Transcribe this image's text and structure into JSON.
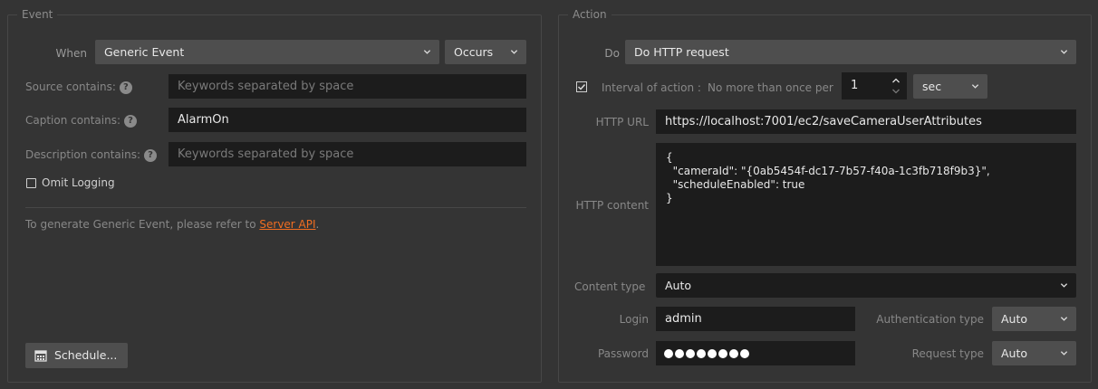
{
  "event": {
    "legend": "Event",
    "when_label": "When",
    "event_type": "Generic Event",
    "occurs": "Occurs",
    "source_label": "Source contains:",
    "source_placeholder": "Keywords separated by space",
    "caption_label": "Caption contains:",
    "caption_value": "AlarmOn",
    "description_label": "Description contains:",
    "description_placeholder": "Keywords separated by space",
    "omit_logging": "Omit Logging",
    "hint_prefix": "To generate Generic Event, please refer to ",
    "hint_link": "Server API",
    "hint_suffix": ".",
    "schedule_button": "Schedule..."
  },
  "action": {
    "legend": "Action",
    "do_label": "Do",
    "action_type": "Do HTTP request",
    "interval_label": "Interval of action :",
    "interval_text": "No more than once per",
    "interval_value": "1",
    "interval_unit": "sec",
    "url_label": "HTTP URL",
    "url_value": "https://localhost:7001/ec2/saveCameraUserAttributes",
    "content_label": "HTTP content",
    "content_value": "{\n  \"cameraId\": \"{0ab5454f-dc17-7b57-f40a-1c3fb718f9b3}\",\n  \"scheduleEnabled\": true\n}",
    "content_type_label": "Content type",
    "content_type_value": "Auto",
    "login_label": "Login",
    "login_value": "admin",
    "password_label": "Password",
    "auth_type_label": "Authentication type",
    "auth_type_value": "Auto",
    "request_type_label": "Request type",
    "request_type_value": "Auto"
  },
  "icons": {
    "chevron": "chevron-down-icon",
    "help": "help-icon",
    "calendar": "calendar-icon",
    "checkbox_checked": "checkbox-checked-icon",
    "spin": "spin-arrows-icon"
  },
  "colors": {
    "background": "#343434",
    "field": "#1c1c1c",
    "combo": "#4e4e4e",
    "link": "#f26e21"
  }
}
